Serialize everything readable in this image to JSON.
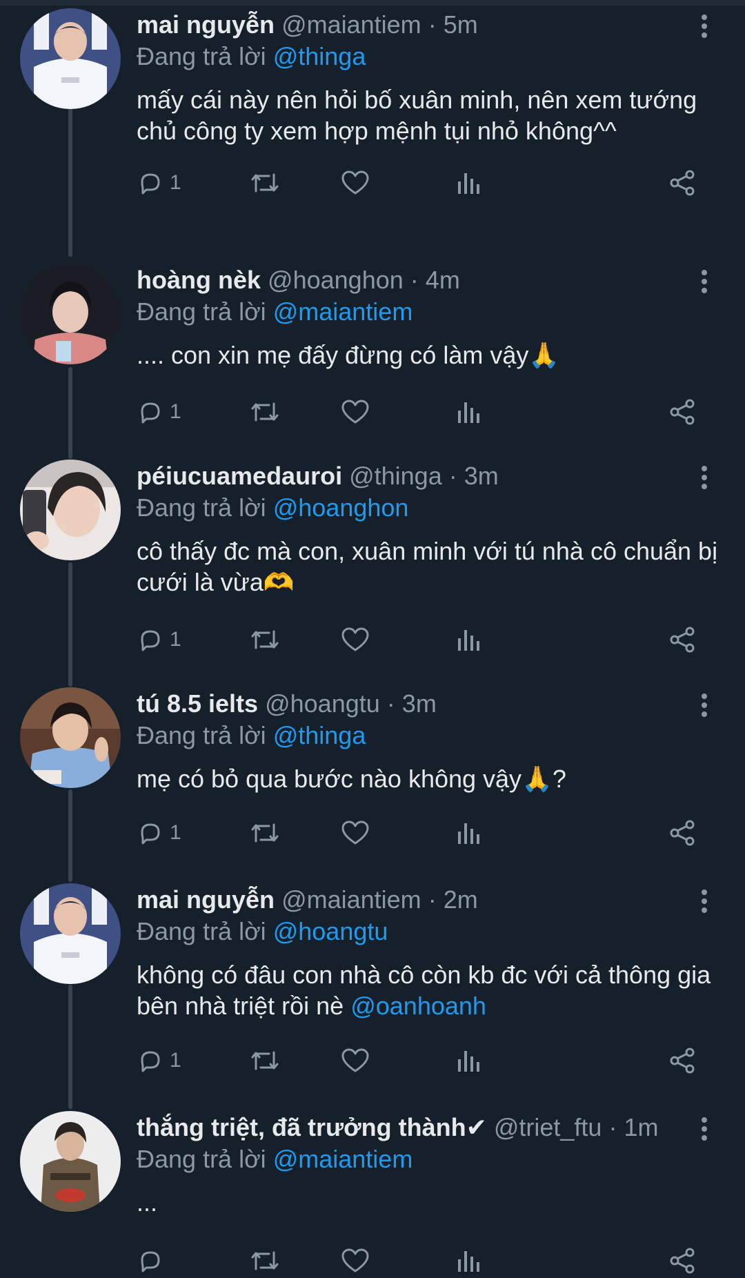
{
  "colors": {
    "background": "#15202b",
    "text": "#e7e9ea",
    "muted": "#8b98a5",
    "link": "#1d9bf0",
    "thread_line": "#38444d"
  },
  "icons": {
    "reply": "reply-icon",
    "retweet": "retweet-icon",
    "like": "heart-icon",
    "views": "views-icon",
    "share": "share-icon",
    "more": "more-vertical-icon"
  },
  "replying_label": "Đang trả lời",
  "tweets": [
    {
      "name": "mai nguyễn",
      "handle": "@maiantiem",
      "time": "5m",
      "reply_to": "@thinga",
      "text": "mấy cái này nên hỏi bố xuân minh, nên xem tướng chủ công ty xem hợp mệnh tụi nhỏ không^^",
      "mention": "",
      "reply_count": "1"
    },
    {
      "name": "hoàng nèk",
      "handle": "@hoanghon",
      "time": "4m",
      "reply_to": "@maiantiem",
      "text": ".... con xin mẹ đấy đừng có làm vậy🙏",
      "mention": "",
      "reply_count": "1"
    },
    {
      "name": "péiucuamedauroi",
      "handle": "@thinga",
      "time": "3m",
      "reply_to": "@hoanghon",
      "text": "cô thấy đc mà con, xuân minh với tú nhà cô chuẩn bị cưới là vừa🫶",
      "mention": "",
      "reply_count": "1"
    },
    {
      "name": "tú 8.5 ielts",
      "handle": "@hoangtu",
      "time": "3m",
      "reply_to": "@thinga",
      "text": "mẹ có bỏ qua bước nào không vậy🙏?",
      "mention": "",
      "reply_count": "1"
    },
    {
      "name": "mai nguyễn",
      "handle": "@maiantiem",
      "time": "2m",
      "reply_to": "@hoangtu",
      "text": "không có đâu con nhà cô còn kb đc với cả thông gia bên nhà triệt rồi nè ",
      "mention": "@oanhoanh",
      "reply_count": "1"
    },
    {
      "name": "thắng triệt, đã trưởng thành✔",
      "handle": "@triet_ftu",
      "time": "1m",
      "reply_to": "@maiantiem",
      "text": "...",
      "mention": "",
      "reply_count": ""
    }
  ]
}
